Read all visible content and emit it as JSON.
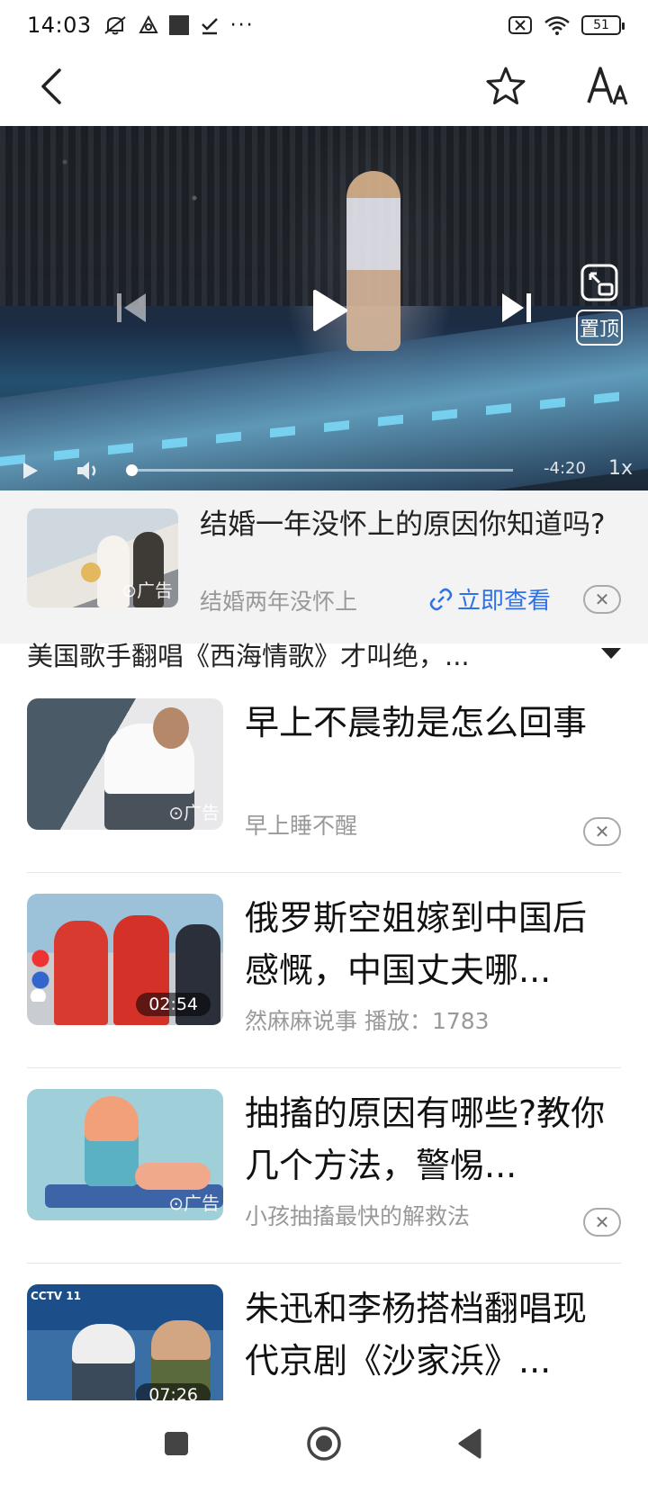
{
  "status_bar": {
    "time": "14:03",
    "more": "···",
    "battery": "51"
  },
  "video": {
    "time_remaining": "-4:20",
    "speed": "1x",
    "pin_label": "置顶",
    "progress": 0
  },
  "ad_banner": {
    "title": "结婚一年没怀上的原因你知道吗?",
    "subtitle": "结婚两年没怀上",
    "link_label": "立即查看",
    "ad_mark": "广告"
  },
  "video_title": "美国歌手翻唱《西海情歌》才叫绝，...",
  "feed": [
    {
      "title": "早上不晨勃是怎么回事",
      "meta": "早上睡不醒",
      "badge": "广告",
      "is_ad": true
    },
    {
      "title": "俄罗斯空姐嫁到中国后感慨，中国丈夫哪...",
      "meta": "然麻麻说事  播放：1783",
      "badge": "02:54",
      "is_ad": false
    },
    {
      "title": "抽搐的原因有哪些?教你几个方法，警惕...",
      "meta": "小孩抽搐最快的解救法",
      "badge": "广告",
      "is_ad": true
    },
    {
      "title": "朱迅和李杨搭档翻唱现代京剧《沙家浜》...",
      "meta": "",
      "badge": "07:26",
      "is_ad": false
    }
  ],
  "thumb_logo": "CCTV 11"
}
